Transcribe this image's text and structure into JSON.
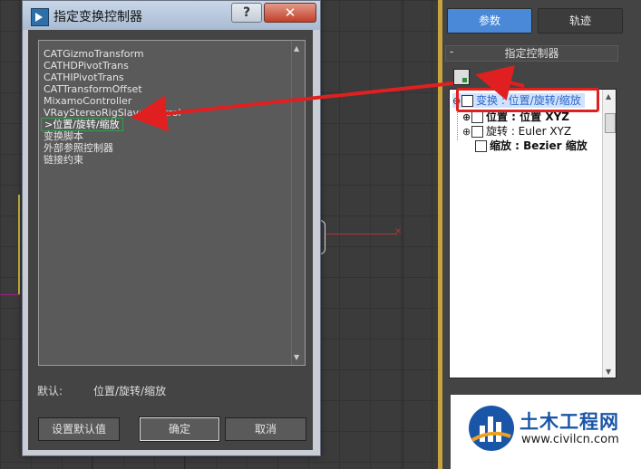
{
  "dialog": {
    "title": "指定变换控制器",
    "help_label": "?",
    "close_label": "✕",
    "controllers": [
      "CATGizmoTransform",
      "CATHDPivotTrans",
      "CATHIPivotTrans",
      "CATTransformOffset",
      "MixamoController",
      "VRayStereoRigSlaveControl",
      ">位置/旋转/缩放",
      "变换脚本",
      "外部参照控制器",
      "链接约束"
    ],
    "selected_index": 6,
    "default_label": "默认:",
    "default_value": "位置/旋转/缩放",
    "set_default_button": "设置默认值",
    "ok_button": "确定",
    "cancel_button": "取消"
  },
  "command_panel": {
    "tabs": [
      "参数",
      "轨迹"
    ],
    "active_tab": "参数",
    "rollout_toggle": "-",
    "rollout_title": "指定控制器",
    "tree": {
      "transform": "变换 : 位置/旋转/缩放",
      "position": "位置 : 位置 XYZ",
      "rotation": "旋转 : Euler XYZ",
      "scale": "缩放 : Bezier 缩放"
    }
  },
  "watermark": {
    "title": "土木工程网",
    "url": "www.civilcn.com"
  },
  "colors": {
    "accent_blue": "#4a88d8",
    "annotation_red": "#e02020",
    "selection_green": "#2ea24a"
  }
}
